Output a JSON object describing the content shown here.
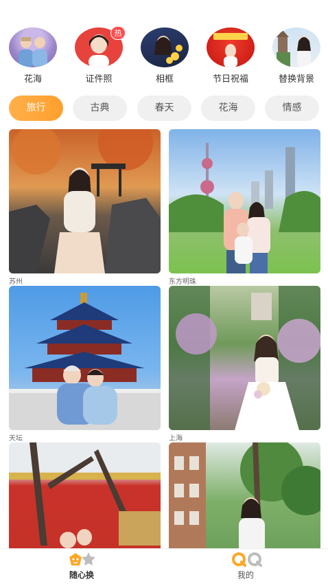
{
  "categories": [
    {
      "label": "花海"
    },
    {
      "label": "证件照",
      "badge": "热"
    },
    {
      "label": "相框"
    },
    {
      "label": "节日祝福"
    },
    {
      "label": "替换背景"
    }
  ],
  "tags": [
    {
      "label": "旅行",
      "active": true
    },
    {
      "label": "古典"
    },
    {
      "label": "春天"
    },
    {
      "label": "花海"
    },
    {
      "label": "情感"
    }
  ],
  "cards": [
    {
      "caption": "苏州"
    },
    {
      "caption": "东方明珠"
    },
    {
      "caption": "天坛"
    },
    {
      "caption": "上海"
    },
    {
      "caption": ""
    },
    {
      "caption": ""
    }
  ],
  "tabbar": {
    "items": [
      {
        "label": "随心换",
        "active": true
      },
      {
        "label": "我的"
      }
    ]
  },
  "colors": {
    "accent": "#ff9f2e",
    "hot_badge": "#ff4d4d"
  }
}
